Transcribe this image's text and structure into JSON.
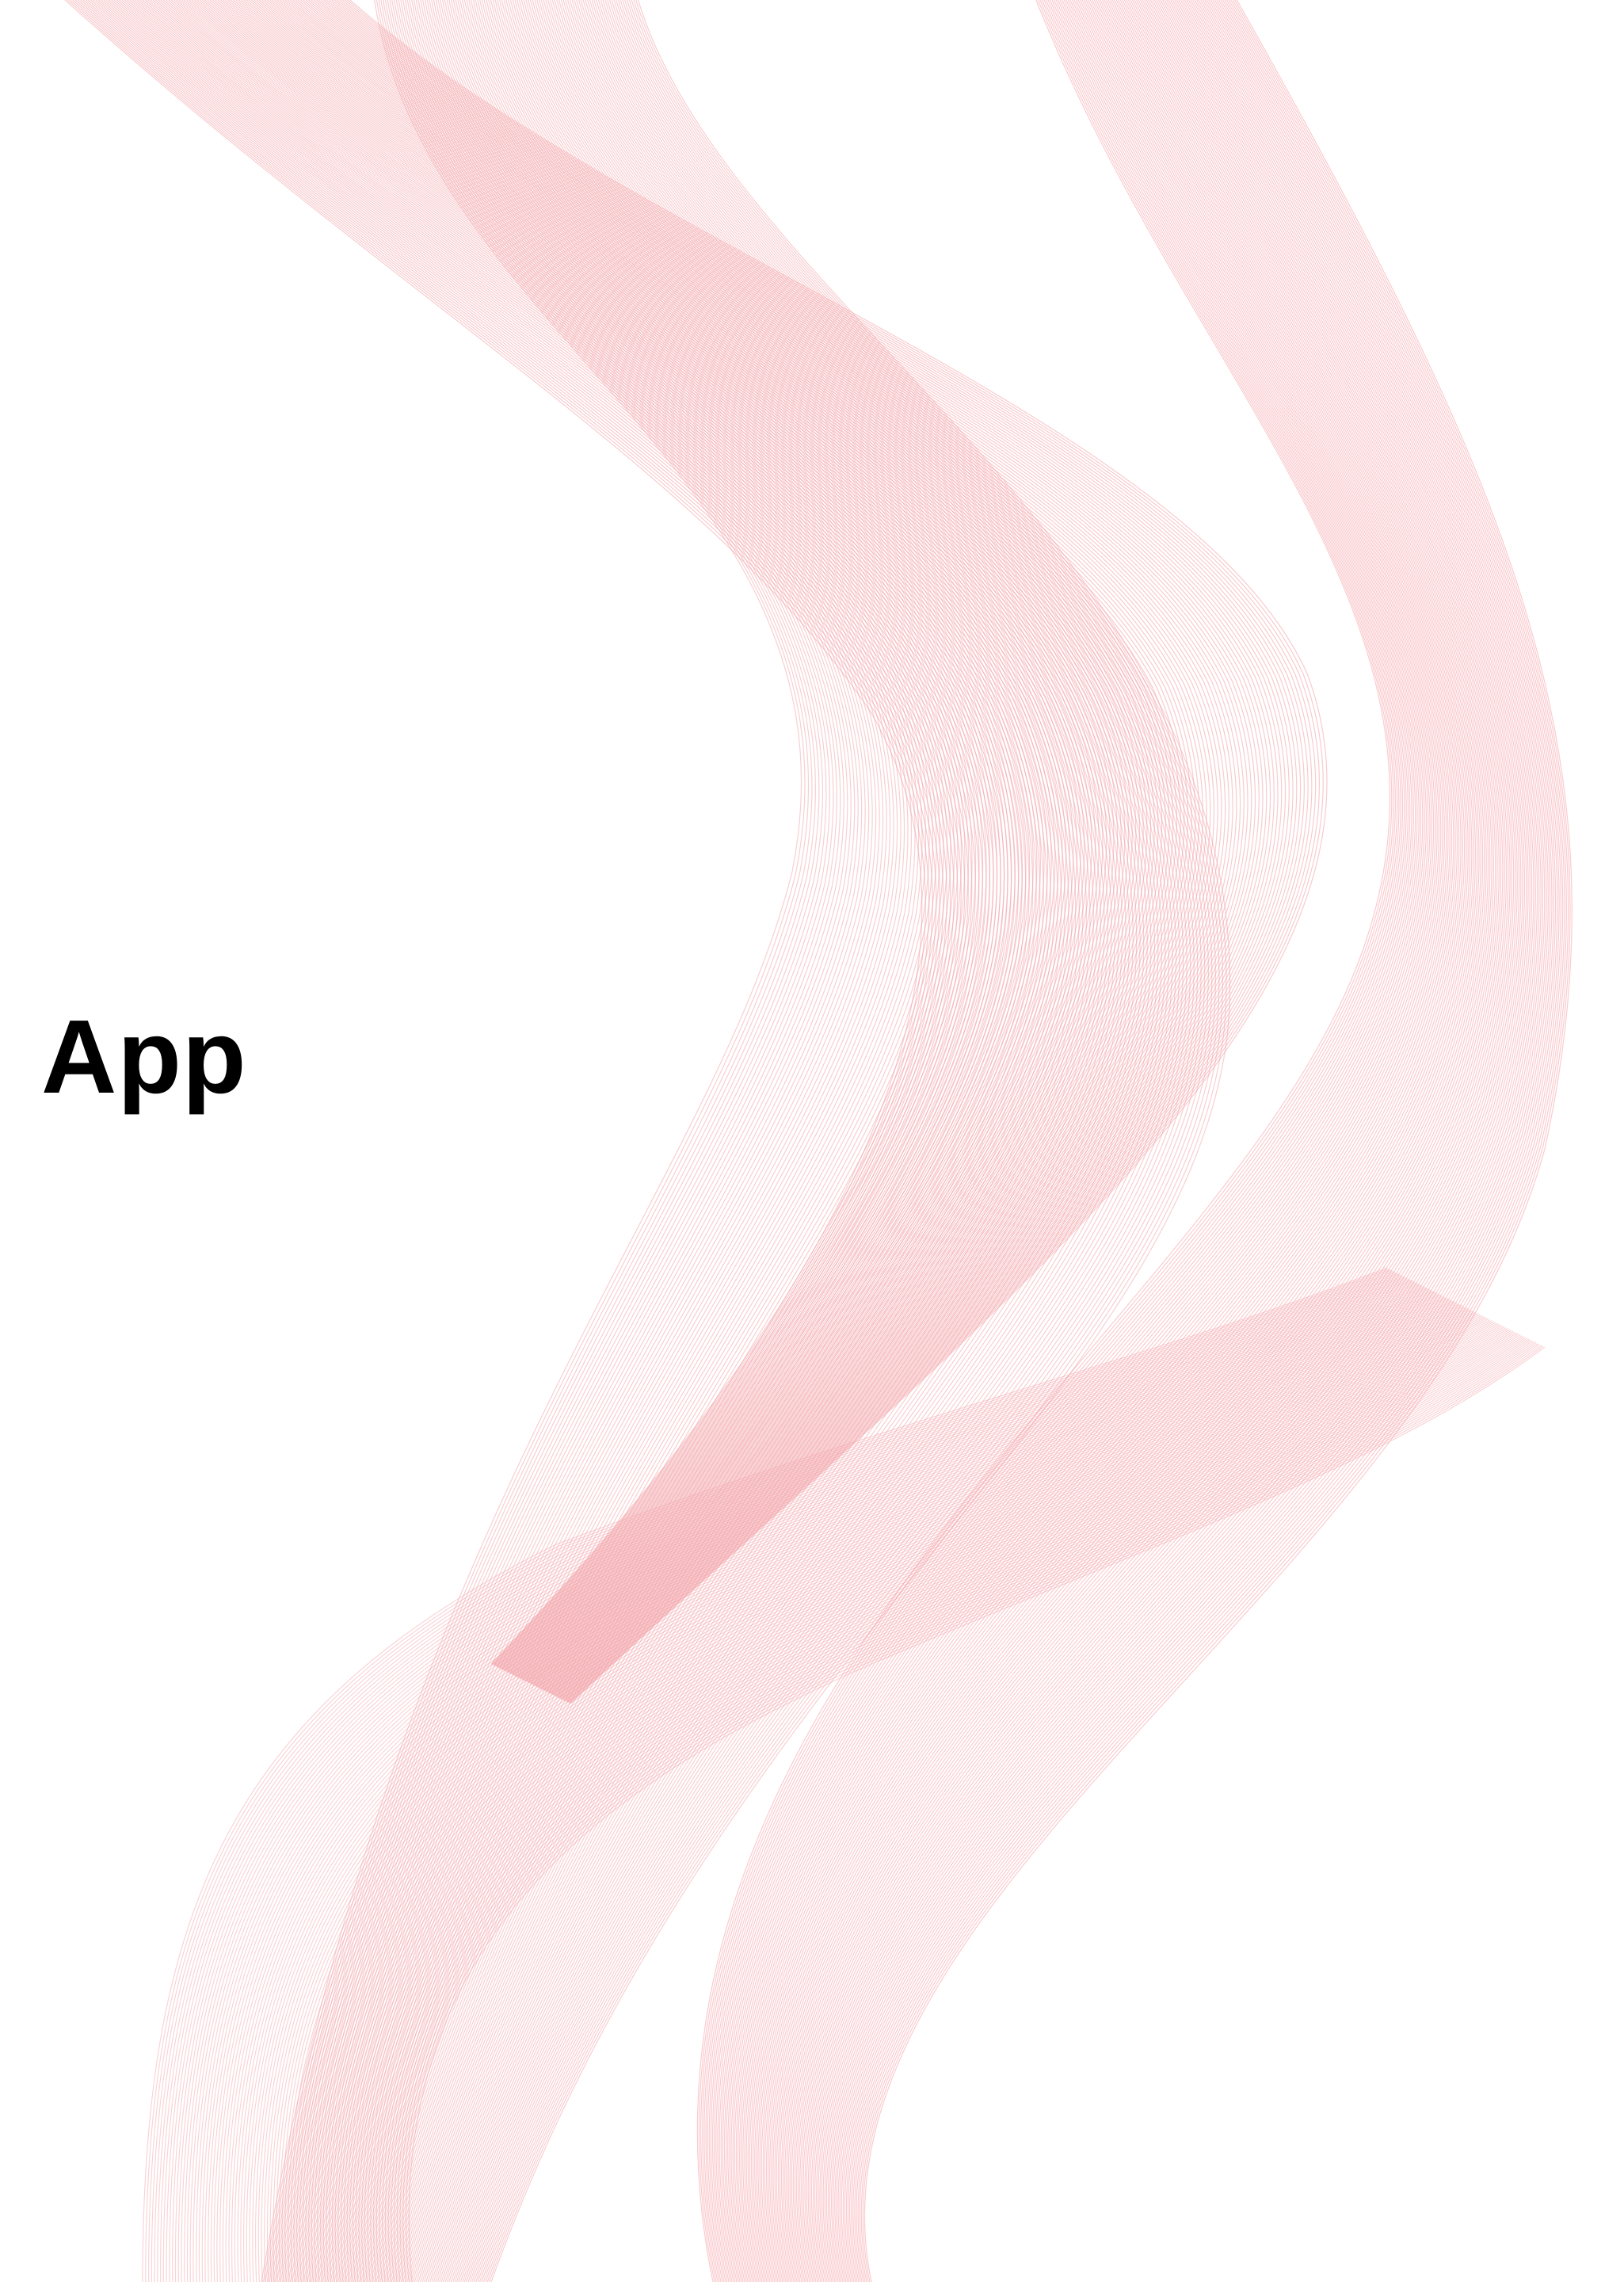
{
  "screen": {
    "title": "App"
  },
  "decoration": {
    "icon": "silk-wave-ribbons",
    "stroke_color": "#f2a0a6",
    "accent_color": "#f48b95",
    "background": "#ffffff"
  }
}
